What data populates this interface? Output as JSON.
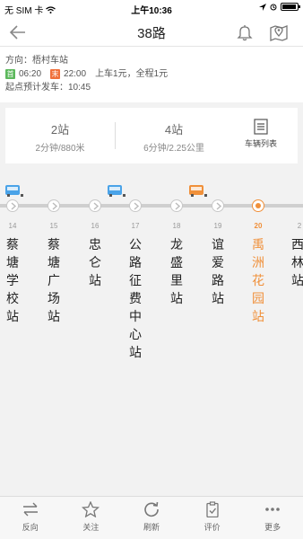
{
  "status": {
    "carrier": "无 SIM 卡",
    "time": "上午10:36"
  },
  "nav": {
    "title": "38路"
  },
  "info": {
    "direction": "方向：梧村车站",
    "first_tag": "首",
    "first_time": "06:20",
    "last_tag": "末",
    "last_time": "22:00",
    "fare": "上车1元，全程1元",
    "depart": "起点预计发车：10:45"
  },
  "summary": {
    "near_stops": "2站",
    "near_detail": "2分钟/880米",
    "far_stops": "4站",
    "far_detail": "6分钟/2.25公里",
    "list_label": "车辆列表"
  },
  "stops": [
    {
      "num": "14",
      "name": "蔡塘学校站"
    },
    {
      "num": "15",
      "name": "蔡塘广场站"
    },
    {
      "num": "16",
      "name": "忠仑站"
    },
    {
      "num": "17",
      "name": "公路征费中心站"
    },
    {
      "num": "18",
      "name": "龙盛里站"
    },
    {
      "num": "19",
      "name": "谊爱路站"
    },
    {
      "num": "20",
      "name": "禹洲花园站"
    },
    {
      "num": "2",
      "name": "西林站"
    }
  ],
  "colors": {
    "accent": "#f0903a",
    "bus_blue": "#4aa3e8",
    "first_green": "#5cb85c",
    "last_orange": "#f0703a"
  },
  "tabs": [
    {
      "label": "反向",
      "icon": "swap-icon"
    },
    {
      "label": "关注",
      "icon": "star-icon"
    },
    {
      "label": "刷新",
      "icon": "refresh-icon"
    },
    {
      "label": "评价",
      "icon": "clipboard-check-icon"
    },
    {
      "label": "更多",
      "icon": "more-dots-icon"
    }
  ]
}
